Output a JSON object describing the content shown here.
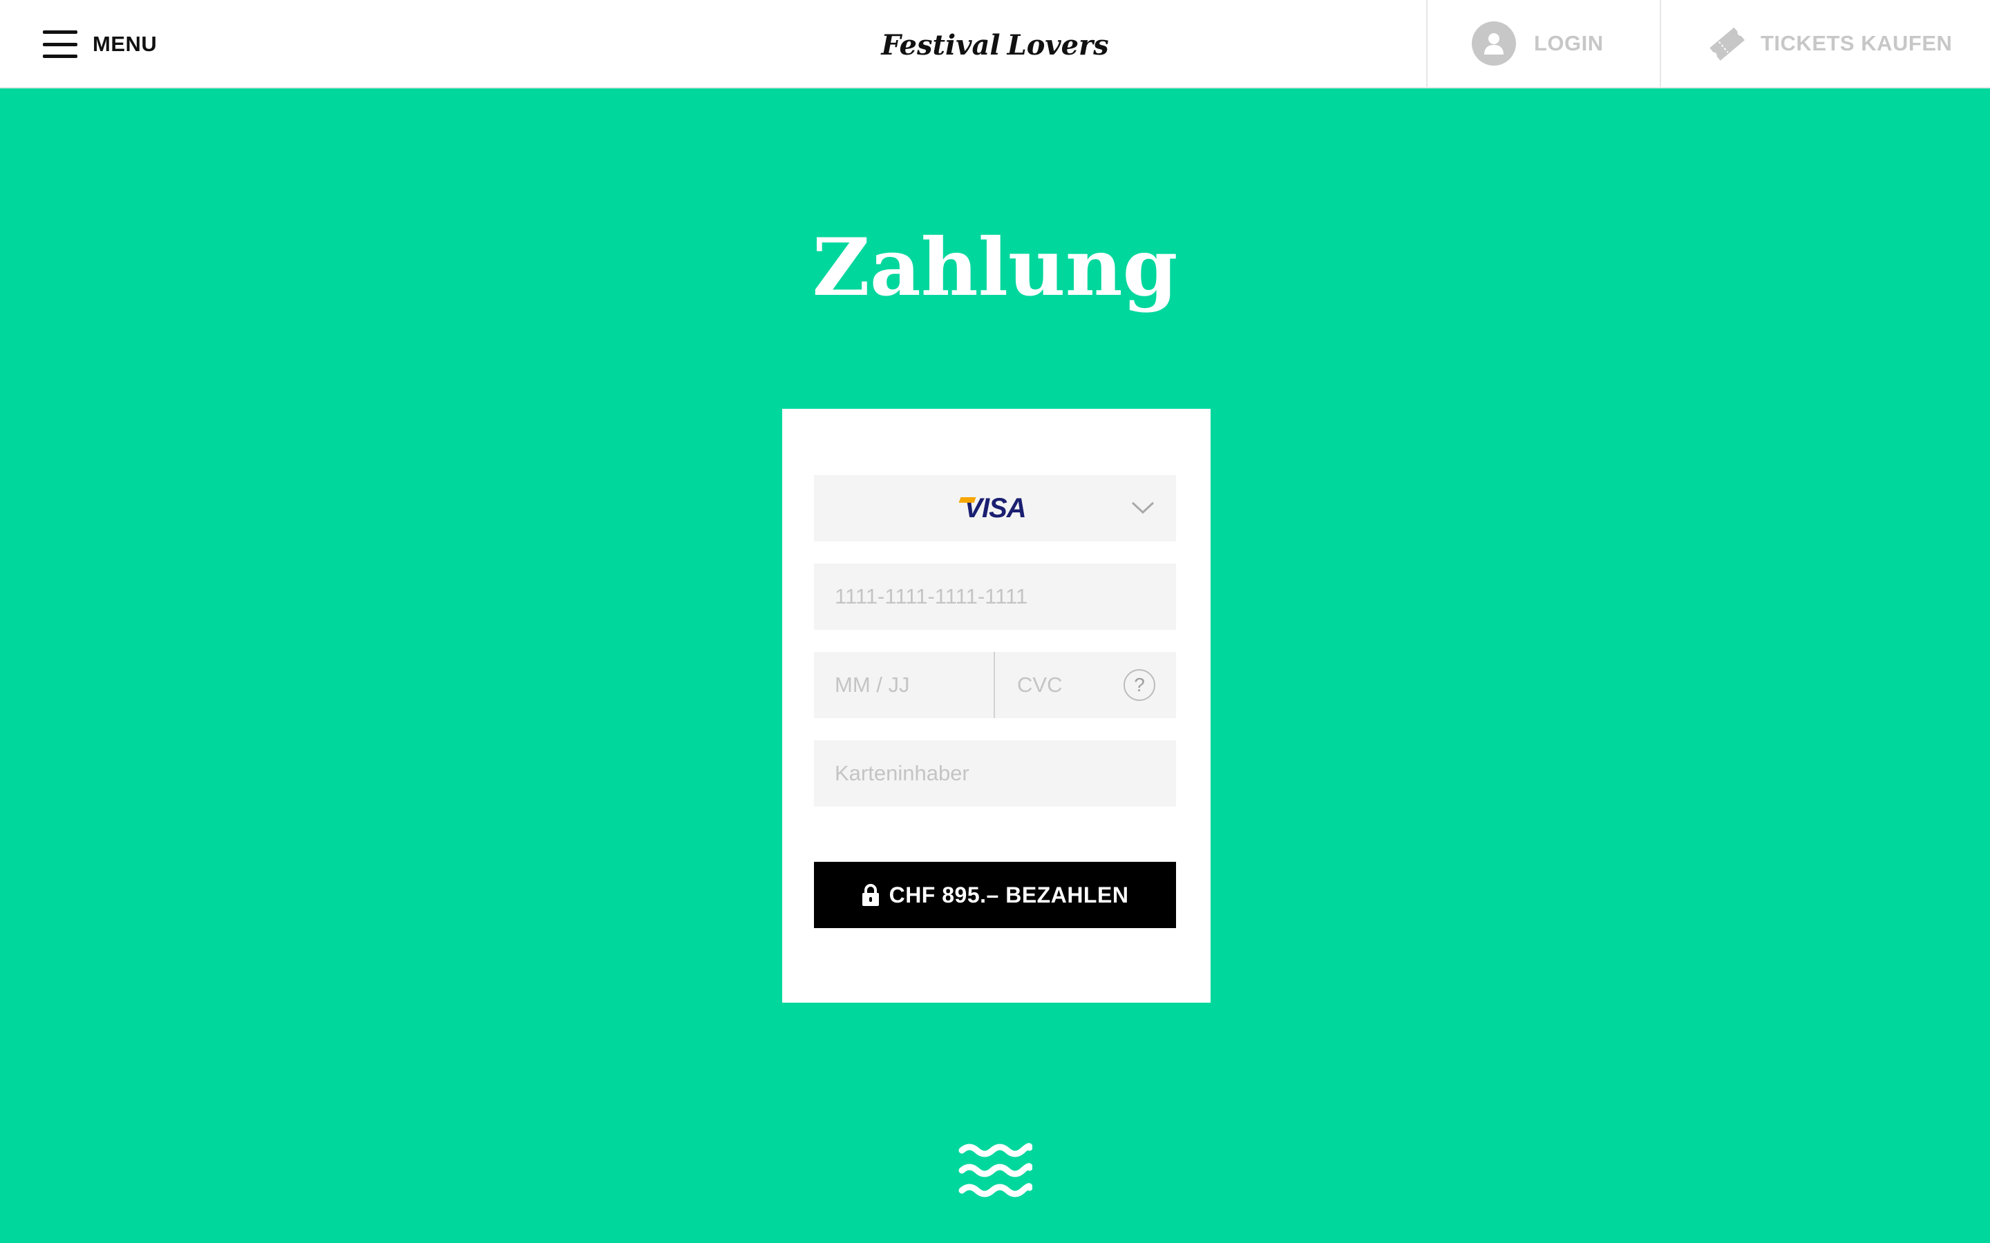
{
  "header": {
    "menu_label": "MENU",
    "logo": {
      "left_word": "Festival",
      "right_word": "Lovers"
    },
    "login_label": "LOGIN",
    "tickets_label": "TICKETS KAUFEN"
  },
  "page": {
    "title": "Zahlung"
  },
  "payment_form": {
    "card_type": "VISA",
    "card_number_placeholder": "1111-1111-1111-1111",
    "expiry_placeholder": "MM / JJ",
    "cvc_placeholder": "CVC",
    "cvc_help": "?",
    "cardholder_placeholder": "Karteninhaber",
    "pay_button_label": "CHF 895.– BEZAHLEN"
  },
  "colors": {
    "background": "#00d79d",
    "header_bg": "#ffffff",
    "input_bg": "#f4f4f4",
    "button_bg": "#000000",
    "visa_blue": "#1a1f71",
    "visa_gold": "#f7a600",
    "muted_gray": "#c7c7c7"
  },
  "icons": {
    "menu": "hamburger-icon",
    "logo_heart": "heart-icon",
    "login": "user-icon",
    "tickets": "ticket-icon",
    "dropdown": "chevron-down-icon",
    "help": "question-icon",
    "pay": "lock-icon",
    "footer": "waves-icon"
  }
}
